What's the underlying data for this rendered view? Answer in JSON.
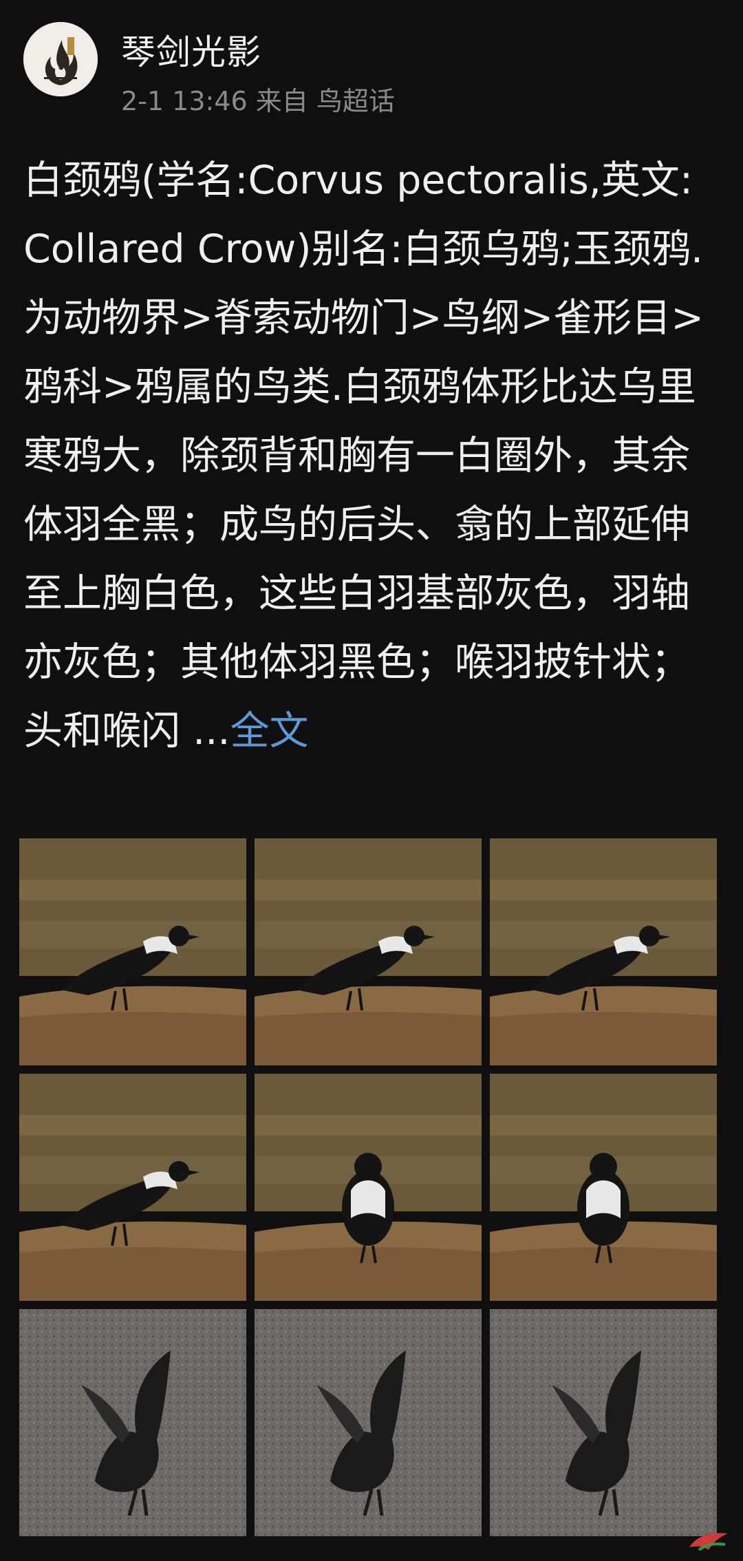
{
  "header": {
    "username": "琴剑光影",
    "time": "2-1 13:46",
    "from_prefix": "来自",
    "source": "鸟超话"
  },
  "post": {
    "text": "白颈鸦(学名:Corvus pectoralis,英文:Collared Crow)别名:白颈乌鸦;玉颈鸦.为动物界>脊索动物门>鸟纲>雀形目>鸦科>鸦属的鸟类.白颈鸦体形比达乌里寒鸦大，除颈背和胸有一白圈外，其余体羽全黑；成鸟的后头、翕的上部延伸至上胸白色，这些白羽基部灰色，羽轴亦灰色；其他体羽黑色；喉羽披针状；头和喉闪",
    "ellipsis": " ...",
    "more_label": "全文"
  },
  "photos": [
    {
      "scene": "waterside",
      "pose": "walking-left"
    },
    {
      "scene": "waterside",
      "pose": "walking-left"
    },
    {
      "scene": "waterside",
      "pose": "stepping"
    },
    {
      "scene": "waterside",
      "pose": "side-standing"
    },
    {
      "scene": "waterside",
      "pose": "front-standing"
    },
    {
      "scene": "waterside",
      "pose": "front-standing"
    },
    {
      "scene": "mudflat",
      "pose": "wings-up"
    },
    {
      "scene": "mudflat",
      "pose": "wings-up"
    },
    {
      "scene": "mudflat",
      "pose": "wings-spread"
    }
  ],
  "icons": {
    "avatar": "flame-logo-icon",
    "watermark": "bird-watermark-icon"
  },
  "colors": {
    "background": "#0f0f10",
    "link": "#5c9bd8",
    "meta": "#8a8a8a"
  }
}
